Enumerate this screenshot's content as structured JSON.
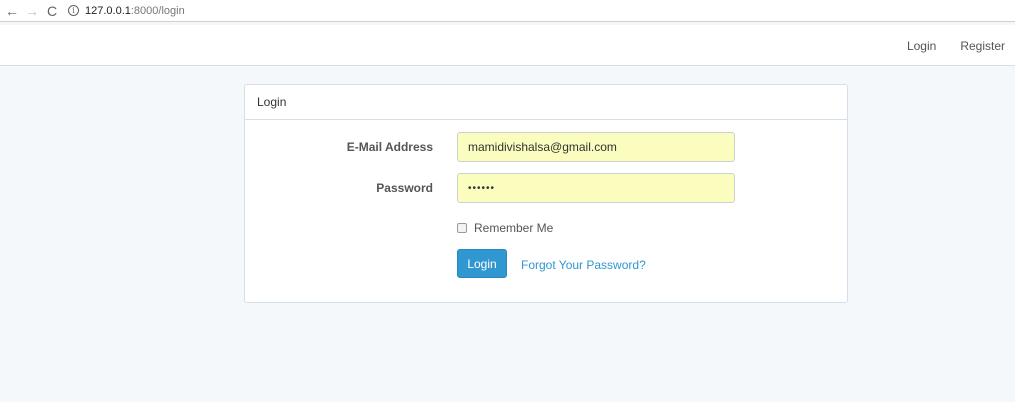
{
  "browser": {
    "back_icon": "←",
    "forward_icon": "→",
    "reload_icon": "C",
    "info_icon": "i",
    "url_host": "127.0.0.1",
    "url_path": ":8000/login"
  },
  "navbar": {
    "login_label": "Login",
    "register_label": "Register"
  },
  "panel": {
    "title": "Login",
    "email_label": "E-Mail Address",
    "email_value": "mamidivishalsa@gmail.com",
    "password_label": "Password",
    "password_value": "••••••",
    "remember_label": "Remember Me",
    "remember_checked": false,
    "login_button": "Login",
    "forgot_link": "Forgot Your Password?"
  },
  "colors": {
    "accent": "#3097d1",
    "autofill_bg": "#fbfdbf",
    "page_bg": "#f5f8fa"
  }
}
